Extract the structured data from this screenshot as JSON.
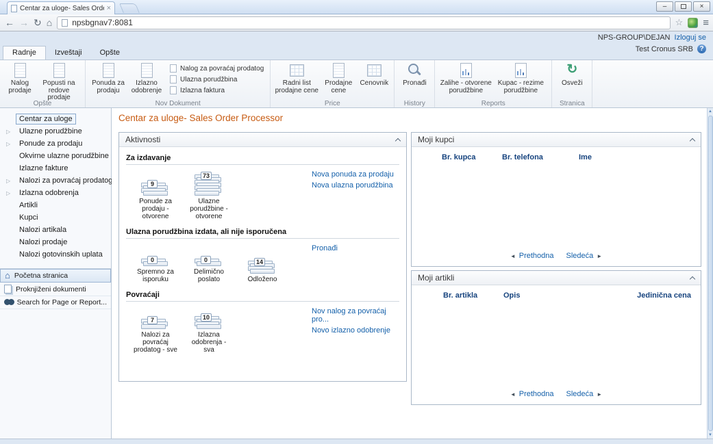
{
  "icons": {
    "back": "←",
    "forward": "→",
    "reload": "↻",
    "home": "⌂",
    "star": "☆",
    "menu": "≡",
    "tab_close": "×",
    "win_min": "–",
    "win_close": "×",
    "help": "?",
    "expand": "▷",
    "prev_arrow": "◄",
    "next_arrow": "►",
    "scroll_up": "▲",
    "scroll_down": "▼",
    "refresh": "↻"
  },
  "browser": {
    "tab_title": "Centar za uloge- Sales Order",
    "url": "npsbgnav7:8081"
  },
  "app_header": {
    "user": "NPS-GROUP\\DEJAN",
    "logout_label": "Izloguj se",
    "company": "Test Cronus SRB"
  },
  "ribbon": {
    "tabs": [
      {
        "label": "Radnje"
      },
      {
        "label": "Izveštaji"
      },
      {
        "label": "Opšte"
      }
    ],
    "groups": [
      {
        "label": "Opšte",
        "items": [
          {
            "label": "Nalog prodaje"
          },
          {
            "label": "Popusti na redove prodaje"
          }
        ]
      },
      {
        "label": "Nov Dokument",
        "items": [
          {
            "label": "Ponuda za prodaju"
          },
          {
            "label": "Izlazno odobrenje"
          }
        ],
        "small_items": [
          "Nalog za povraćaj prodatog",
          "Ulazna porudžbina",
          "Izlazna faktura"
        ]
      },
      {
        "label": "Price",
        "items": [
          {
            "label": "Radni list prodajne cene"
          },
          {
            "label": "Prodajne cene"
          },
          {
            "label": "Cenovnik"
          }
        ]
      },
      {
        "label": "History",
        "items": [
          {
            "label": "Pronađi"
          }
        ]
      },
      {
        "label": "Reports",
        "items": [
          {
            "label": "Zalihe - otvorene porudžbine"
          },
          {
            "label": "Kupac - rezime porudžbine"
          }
        ]
      },
      {
        "label": "Stranica",
        "items": [
          {
            "label": "Osveži"
          }
        ]
      }
    ]
  },
  "sidebar": {
    "items": [
      {
        "label": "Centar za uloge"
      },
      {
        "label": "Ulazne porudžbine"
      },
      {
        "label": "Ponude za prodaju"
      },
      {
        "label": "Okvirne ulazne porudžbine"
      },
      {
        "label": "Izlazne fakture"
      },
      {
        "label": "Nalozi za povraćaj prodatog"
      },
      {
        "label": "Izlazna odobrenja"
      },
      {
        "label": "Artikli"
      },
      {
        "label": "Kupci"
      },
      {
        "label": "Nalozi artikala"
      },
      {
        "label": "Nalozi prodaje"
      },
      {
        "label": "Nalozi gotovinskih uplata"
      }
    ],
    "footer_items": [
      {
        "label": "Početna stranica"
      },
      {
        "label": "Proknjiženi dokumenti"
      },
      {
        "label": "Search for Page or Report..."
      }
    ]
  },
  "main": {
    "title": "Centar za uloge- Sales Order Processor",
    "activities": {
      "title": "Aktivnosti",
      "sections": [
        {
          "heading": "Za izdavanje",
          "tiles": [
            {
              "count": "9",
              "label": "Ponude za prodaju - otvorene"
            },
            {
              "count": "73",
              "label": "Ulazne porudžbine - otvorene"
            }
          ],
          "links": [
            "Nova ponuda za prodaju",
            "Nova ulazna porudžbina"
          ]
        },
        {
          "heading": "Ulazna porudžbina izdata, ali nije isporučena",
          "tiles": [
            {
              "count": "0",
              "label": "Spremno za isporuku"
            },
            {
              "count": "0",
              "label": "Delimično poslato"
            },
            {
              "count": "14",
              "label": "Odloženo"
            }
          ],
          "links": [
            "Pronađi"
          ]
        },
        {
          "heading": "Povraćaji",
          "tiles": [
            {
              "count": "7",
              "label": "Nalozi za povraćaj prodatog - sve"
            },
            {
              "count": "10",
              "label": "Izlazna odobrenja - sva"
            }
          ],
          "links": [
            "Nov nalog za povraćaj pro...",
            "Novo izlazno odobrenje"
          ]
        }
      ]
    },
    "my_customers": {
      "title": "Moji kupci",
      "columns": [
        "Br. kupca",
        "Br. telefona",
        "Ime"
      ],
      "pagination": {
        "prev": "Prethodna",
        "next": "Sledeća"
      }
    },
    "my_items": {
      "title": "Moji artikli",
      "columns": [
        "Br. artikla",
        "Opis",
        "Jedinična cena"
      ],
      "pagination": {
        "prev": "Prethodna",
        "next": "Sledeća"
      }
    }
  }
}
